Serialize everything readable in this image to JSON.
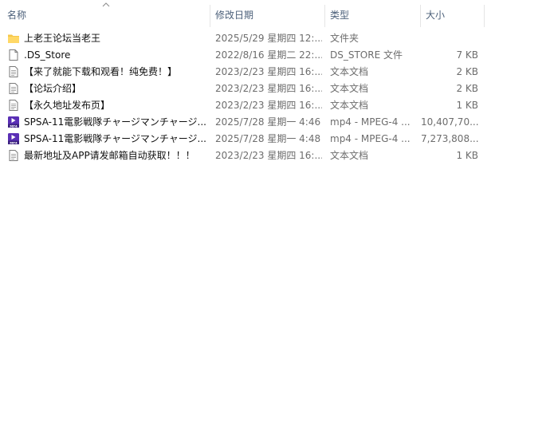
{
  "columns": {
    "name": "名称",
    "modified": "修改日期",
    "type": "类型",
    "size": "大小"
  },
  "files": [
    {
      "icon": "folder-icon",
      "name": "上老王论坛当老王",
      "modified": "2025/5/29 星期四 12:...",
      "type": "文件夹",
      "size": ""
    },
    {
      "icon": "file-icon",
      "name": ".DS_Store",
      "modified": "2022/8/16 星期二 22:...",
      "type": "DS_STORE 文件",
      "size": "7 KB"
    },
    {
      "icon": "text-file-icon",
      "name": "【来了就能下载和观看！纯免费！】",
      "modified": "2023/2/23 星期四 16:...",
      "type": "文本文档",
      "size": "2 KB"
    },
    {
      "icon": "text-file-icon",
      "name": "【论坛介绍】",
      "modified": "2023/2/23 星期四 16:...",
      "type": "文本文档",
      "size": "2 KB"
    },
    {
      "icon": "text-file-icon",
      "name": "【永久地址发布页】",
      "modified": "2023/2/23 星期四 16:...",
      "type": "文本文档",
      "size": "1 KB"
    },
    {
      "icon": "mp4-video-icon",
      "name": "SPSA-11電影戦隊チャージマンチャージ...",
      "modified": "2025/7/28 星期一 4:46",
      "type": "mp4 - MPEG-4 ...",
      "size": "10,407,70..."
    },
    {
      "icon": "mp4-video-icon",
      "name": "SPSA-11電影戦隊チャージマンチャージ...",
      "modified": "2025/7/28 星期一 4:48",
      "type": "mp4 - MPEG-4 ...",
      "size": "7,273,808..."
    },
    {
      "icon": "text-file-icon",
      "name": "最新地址及APP请发邮箱自动获取！！！",
      "modified": "2023/2/23 星期四 16:...",
      "type": "文本文档",
      "size": "1 KB"
    }
  ],
  "colors": {
    "header_text": "#4c607a",
    "secondary_text": "#6d6d6d",
    "folder": "#f5c74a",
    "mp4_icon": "#5a2fb5"
  }
}
